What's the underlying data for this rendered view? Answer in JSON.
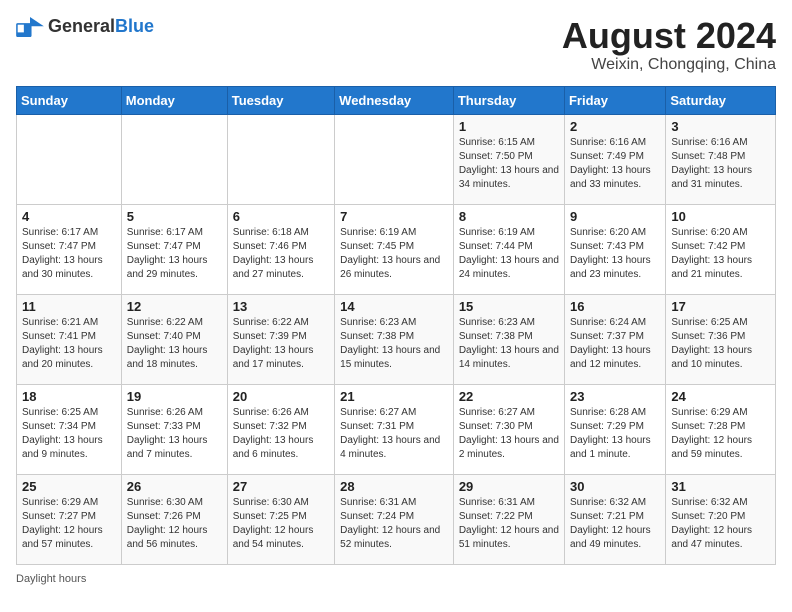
{
  "header": {
    "logo_general": "General",
    "logo_blue": "Blue",
    "main_title": "August 2024",
    "subtitle": "Weixin, Chongqing, China"
  },
  "weekdays": [
    "Sunday",
    "Monday",
    "Tuesday",
    "Wednesday",
    "Thursday",
    "Friday",
    "Saturday"
  ],
  "footer_text": "Daylight hours",
  "weeks": [
    [
      {
        "day": "",
        "sunrise": "",
        "sunset": "",
        "daylight": ""
      },
      {
        "day": "",
        "sunrise": "",
        "sunset": "",
        "daylight": ""
      },
      {
        "day": "",
        "sunrise": "",
        "sunset": "",
        "daylight": ""
      },
      {
        "day": "",
        "sunrise": "",
        "sunset": "",
        "daylight": ""
      },
      {
        "day": "1",
        "sunrise": "6:15 AM",
        "sunset": "7:50 PM",
        "daylight": "13 hours and 34 minutes."
      },
      {
        "day": "2",
        "sunrise": "6:16 AM",
        "sunset": "7:49 PM",
        "daylight": "13 hours and 33 minutes."
      },
      {
        "day": "3",
        "sunrise": "6:16 AM",
        "sunset": "7:48 PM",
        "daylight": "13 hours and 31 minutes."
      }
    ],
    [
      {
        "day": "4",
        "sunrise": "6:17 AM",
        "sunset": "7:47 PM",
        "daylight": "13 hours and 30 minutes."
      },
      {
        "day": "5",
        "sunrise": "6:17 AM",
        "sunset": "7:47 PM",
        "daylight": "13 hours and 29 minutes."
      },
      {
        "day": "6",
        "sunrise": "6:18 AM",
        "sunset": "7:46 PM",
        "daylight": "13 hours and 27 minutes."
      },
      {
        "day": "7",
        "sunrise": "6:19 AM",
        "sunset": "7:45 PM",
        "daylight": "13 hours and 26 minutes."
      },
      {
        "day": "8",
        "sunrise": "6:19 AM",
        "sunset": "7:44 PM",
        "daylight": "13 hours and 24 minutes."
      },
      {
        "day": "9",
        "sunrise": "6:20 AM",
        "sunset": "7:43 PM",
        "daylight": "13 hours and 23 minutes."
      },
      {
        "day": "10",
        "sunrise": "6:20 AM",
        "sunset": "7:42 PM",
        "daylight": "13 hours and 21 minutes."
      }
    ],
    [
      {
        "day": "11",
        "sunrise": "6:21 AM",
        "sunset": "7:41 PM",
        "daylight": "13 hours and 20 minutes."
      },
      {
        "day": "12",
        "sunrise": "6:22 AM",
        "sunset": "7:40 PM",
        "daylight": "13 hours and 18 minutes."
      },
      {
        "day": "13",
        "sunrise": "6:22 AM",
        "sunset": "7:39 PM",
        "daylight": "13 hours and 17 minutes."
      },
      {
        "day": "14",
        "sunrise": "6:23 AM",
        "sunset": "7:38 PM",
        "daylight": "13 hours and 15 minutes."
      },
      {
        "day": "15",
        "sunrise": "6:23 AM",
        "sunset": "7:38 PM",
        "daylight": "13 hours and 14 minutes."
      },
      {
        "day": "16",
        "sunrise": "6:24 AM",
        "sunset": "7:37 PM",
        "daylight": "13 hours and 12 minutes."
      },
      {
        "day": "17",
        "sunrise": "6:25 AM",
        "sunset": "7:36 PM",
        "daylight": "13 hours and 10 minutes."
      }
    ],
    [
      {
        "day": "18",
        "sunrise": "6:25 AM",
        "sunset": "7:34 PM",
        "daylight": "13 hours and 9 minutes."
      },
      {
        "day": "19",
        "sunrise": "6:26 AM",
        "sunset": "7:33 PM",
        "daylight": "13 hours and 7 minutes."
      },
      {
        "day": "20",
        "sunrise": "6:26 AM",
        "sunset": "7:32 PM",
        "daylight": "13 hours and 6 minutes."
      },
      {
        "day": "21",
        "sunrise": "6:27 AM",
        "sunset": "7:31 PM",
        "daylight": "13 hours and 4 minutes."
      },
      {
        "day": "22",
        "sunrise": "6:27 AM",
        "sunset": "7:30 PM",
        "daylight": "13 hours and 2 minutes."
      },
      {
        "day": "23",
        "sunrise": "6:28 AM",
        "sunset": "7:29 PM",
        "daylight": "13 hours and 1 minute."
      },
      {
        "day": "24",
        "sunrise": "6:29 AM",
        "sunset": "7:28 PM",
        "daylight": "12 hours and 59 minutes."
      }
    ],
    [
      {
        "day": "25",
        "sunrise": "6:29 AM",
        "sunset": "7:27 PM",
        "daylight": "12 hours and 57 minutes."
      },
      {
        "day": "26",
        "sunrise": "6:30 AM",
        "sunset": "7:26 PM",
        "daylight": "12 hours and 56 minutes."
      },
      {
        "day": "27",
        "sunrise": "6:30 AM",
        "sunset": "7:25 PM",
        "daylight": "12 hours and 54 minutes."
      },
      {
        "day": "28",
        "sunrise": "6:31 AM",
        "sunset": "7:24 PM",
        "daylight": "12 hours and 52 minutes."
      },
      {
        "day": "29",
        "sunrise": "6:31 AM",
        "sunset": "7:22 PM",
        "daylight": "12 hours and 51 minutes."
      },
      {
        "day": "30",
        "sunrise": "6:32 AM",
        "sunset": "7:21 PM",
        "daylight": "12 hours and 49 minutes."
      },
      {
        "day": "31",
        "sunrise": "6:32 AM",
        "sunset": "7:20 PM",
        "daylight": "12 hours and 47 minutes."
      }
    ]
  ]
}
